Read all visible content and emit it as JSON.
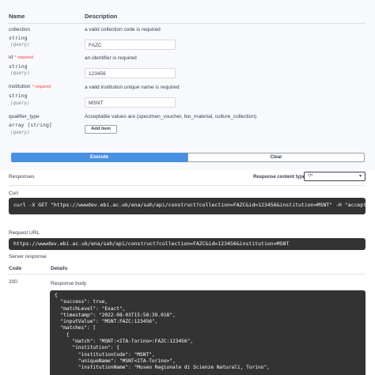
{
  "parameters": {
    "header_name": "Name",
    "header_description": "Description",
    "items": [
      {
        "name": "collection",
        "required": "",
        "type": "string",
        "in": "(query)",
        "description": "a valid collection code is required",
        "value": "FAZC"
      },
      {
        "name": "id",
        "required": "* required",
        "type": "string",
        "in": "(query)",
        "description": "an identifier is required",
        "value": "123456"
      },
      {
        "name": "institution",
        "required": "* required",
        "type": "string",
        "in": "(query)",
        "description": "a valid institution unique name is required",
        "value": "MSNT"
      },
      {
        "name": "qualifier_type",
        "required": "",
        "type": "array [string]",
        "in": "(query)",
        "description": "Acceptable values are (specimen_voucher, bio_material, culture_collection)",
        "value": ""
      }
    ],
    "add_item_label": "Add item"
  },
  "actions": {
    "execute_label": "Execute",
    "clear_label": "Clear"
  },
  "responses": {
    "title": "Responses",
    "content_type_label": "Response content type",
    "content_type_value": "*/*",
    "curl_label": "Curl",
    "curl_command": "curl -X GET \"https://wwwdev.ebi.ac.uk/ena/sah/api/construct?collection=FAZC&id=123456&institution=MSNT\" -H \"accept: */*\"",
    "request_url_label": "Request URL",
    "request_url": "https://wwwdev.ebi.ac.uk/ena/sah/api/construct?collection=FAZC&id=123456&institution=MSNT",
    "server_response_label": "Server response",
    "code_header": "Code",
    "details_header": "Details",
    "status_code": "200",
    "response_body_label": "Response body",
    "body_lines": [
      "{",
      "  \"success\": true,",
      "  \"matchLevel\": \"Exact\",",
      "  \"timestamp\": \"2022-08-03T15:58:39.018\",",
      "  \"inputValue\": \"MSNT:FAZC:123456\",",
      "  \"matches\": [",
      "    {",
      "      \"match\": \"MSNT:<ITA-Torino>:FAZC:123456\",",
      "      \"institution\": {",
      "        \"institutionCode\": \"MSNT\",",
      "        \"uniqueName\": \"MSNT<ITA-Torino>\",",
      "        \"institutionName\": \"Museo Regionale di Scienze Naturali, Torino\","
    ]
  }
}
